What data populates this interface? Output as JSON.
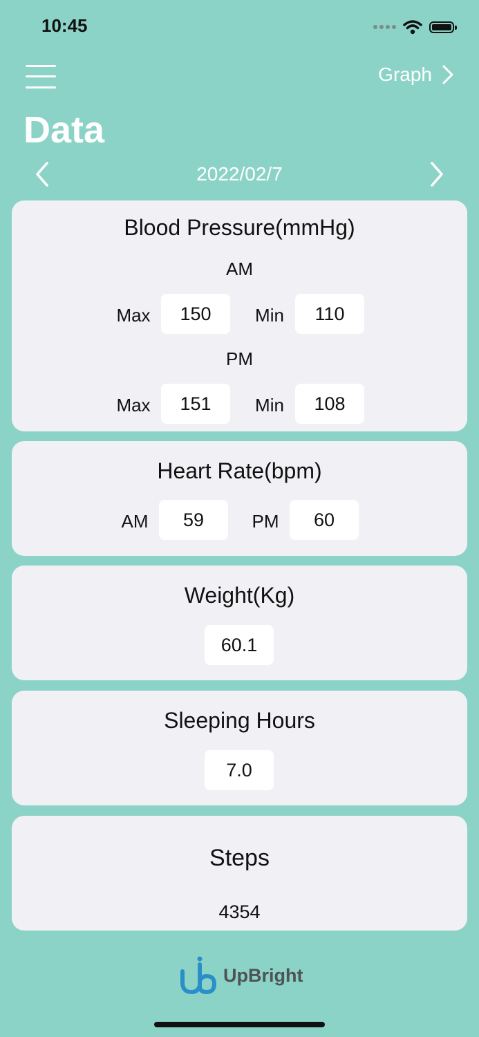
{
  "status_bar": {
    "time": "10:45"
  },
  "nav": {
    "graph_label": "Graph",
    "title": "Data"
  },
  "date_nav": {
    "date": "2022/02/7"
  },
  "blood_pressure": {
    "title": "Blood Pressure(mmHg)",
    "am_label": "AM",
    "pm_label": "PM",
    "max_label": "Max",
    "min_label": "Min",
    "am_max": "150",
    "am_min": "110",
    "pm_max": "151",
    "pm_min": "108"
  },
  "heart_rate": {
    "title": "Heart Rate(bpm)",
    "am_label": "AM",
    "pm_label": "PM",
    "am_value": "59",
    "pm_value": "60"
  },
  "weight": {
    "title": "Weight(Kg)",
    "value": "60.1"
  },
  "sleeping": {
    "title": "Sleeping Hours",
    "value": "7.0"
  },
  "steps": {
    "title": "Steps",
    "value": "4354"
  },
  "footer": {
    "brand": "UpBright"
  },
  "colors": {
    "background": "#8cd3c7",
    "card": "#f1f1f5",
    "brand_blue": "#2a8fc8"
  }
}
